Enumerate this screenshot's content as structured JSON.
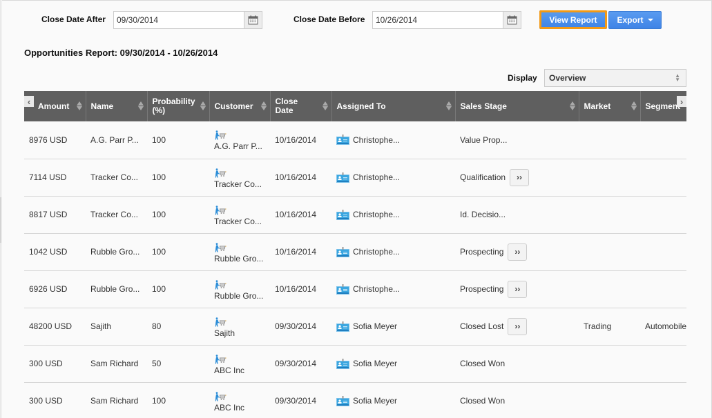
{
  "filters": {
    "after_label": "Close Date After",
    "after_value": "09/30/2014",
    "before_label": "Close Date Before",
    "before_value": "10/26/2014",
    "calendar_icon": "calendar-icon"
  },
  "toolbar": {
    "view_report_label": "View Report",
    "export_label": "Export"
  },
  "report": {
    "title": "Opportunities Report: 09/30/2014 - 10/26/2014"
  },
  "display": {
    "label": "Display",
    "selected": "Overview"
  },
  "table": {
    "columns": [
      {
        "label": "Amount"
      },
      {
        "label": "Name"
      },
      {
        "label": "Probability (%)"
      },
      {
        "label": "Customer"
      },
      {
        "label": "Close Date"
      },
      {
        "label": "Assigned To"
      },
      {
        "label": "Sales Stage"
      },
      {
        "label": "Market"
      },
      {
        "label": "Segment"
      }
    ],
    "rows": [
      {
        "amount": "8976 USD",
        "name": "A.G. Parr P...",
        "probability": "100",
        "customer": "A.G. Parr P...",
        "close_date": "10/16/2014",
        "assigned_to": "Christophe...",
        "sales_stage": "Value Prop...",
        "advance": false,
        "market": "",
        "segment": ""
      },
      {
        "amount": "7114 USD",
        "name": "Tracker Co...",
        "probability": "100",
        "customer": "Tracker Co...",
        "close_date": "10/16/2014",
        "assigned_to": "Christophe...",
        "sales_stage": "Qualification",
        "advance": true,
        "market": "",
        "segment": ""
      },
      {
        "amount": "8817 USD",
        "name": "Tracker Co...",
        "probability": "100",
        "customer": "Tracker Co...",
        "close_date": "10/16/2014",
        "assigned_to": "Christophe...",
        "sales_stage": "Id. Decisio...",
        "advance": false,
        "market": "",
        "segment": ""
      },
      {
        "amount": "1042 USD",
        "name": "Rubble Gro...",
        "probability": "100",
        "customer": "Rubble Gro...",
        "close_date": "10/16/2014",
        "assigned_to": "Christophe...",
        "sales_stage": "Prospecting",
        "advance": true,
        "market": "",
        "segment": ""
      },
      {
        "amount": "6926 USD",
        "name": "Rubble Gro...",
        "probability": "100",
        "customer": "Rubble Gro...",
        "close_date": "10/16/2014",
        "assigned_to": "Christophe...",
        "sales_stage": "Prospecting",
        "advance": true,
        "market": "",
        "segment": ""
      },
      {
        "amount": "48200 USD",
        "name": "Sajith",
        "probability": "80",
        "customer": "Sajith",
        "close_date": "09/30/2014",
        "assigned_to": "Sofia Meyer",
        "sales_stage": "Closed Lost",
        "advance": true,
        "market": "Trading",
        "segment": "Automobile"
      },
      {
        "amount": "300 USD",
        "name": "Sam Richard",
        "probability": "50",
        "customer": "ABC Inc",
        "close_date": "09/30/2014",
        "assigned_to": "Sofia Meyer",
        "sales_stage": "Closed Won",
        "advance": false,
        "market": "",
        "segment": ""
      },
      {
        "amount": "300 USD",
        "name": "Sam Richard",
        "probability": "100",
        "customer": "ABC Inc",
        "close_date": "09/30/2014",
        "assigned_to": "Sofia Meyer",
        "sales_stage": "Closed Won",
        "advance": false,
        "market": "",
        "segment": ""
      }
    ],
    "advance_label": "››",
    "scroll_left": "‹",
    "scroll_right": "›"
  },
  "colors": {
    "primary_button": "#4a8fec",
    "focus_outline": "#f39a16",
    "header_bg": "#5f5f5f",
    "icon_blue": "#2f8fd8"
  }
}
